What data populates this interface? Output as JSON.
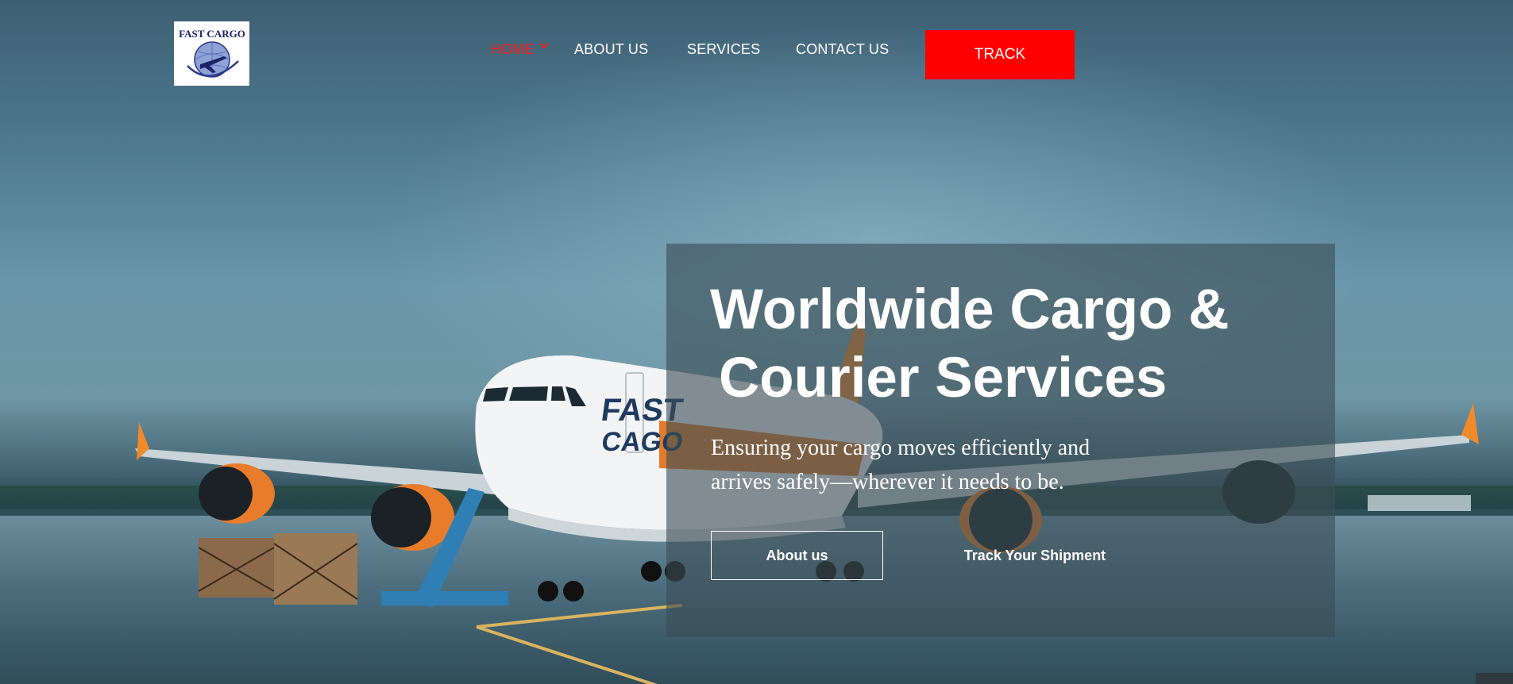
{
  "header": {
    "logo_text": "FAST CARGO",
    "nav": [
      {
        "label": "HOME",
        "active": true
      },
      {
        "label": "ABOUT US"
      },
      {
        "label": "SERVICES"
      },
      {
        "label": "CONTACT US"
      }
    ],
    "track_label": "TRACK"
  },
  "hero": {
    "title_line1": "Worldwide Cargo &",
    "title_line2": "Courier Services",
    "subtitle": "Ensuring your cargo moves efficiently and arrives safely—wherever it needs to be.",
    "about_button": "About us",
    "track_button": "Track Your Shipment",
    "plane_livery": "FAST CAGO"
  },
  "colors": {
    "accent": "#ff0000",
    "active_nav": "#ff1a1a",
    "text": "#ffffff",
    "overlay": "rgba(60,78,86,0.62)"
  }
}
